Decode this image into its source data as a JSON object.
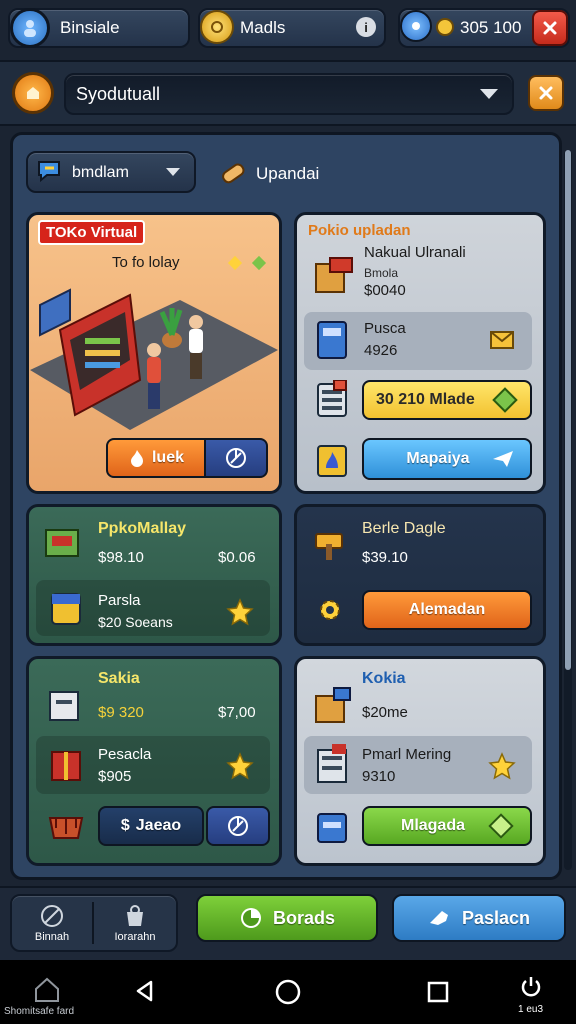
{
  "topbar": {
    "profile_label": "Binsiale",
    "medals_label": "Madls",
    "coins_value": "305 100"
  },
  "header": {
    "dropdown_value": "Syodutuall"
  },
  "subheader": {
    "filter_value": "bmdlam",
    "update_label": "Upandai"
  },
  "cards": {
    "store": {
      "badge": "TOKo Virtual",
      "subtitle": "To fo lolay",
      "primary_label": "luek"
    },
    "updates": {
      "title": "Pokio upladan",
      "item1_name": "Nakual Ulranali",
      "item1_line2": "Bmola",
      "item1_value": "$0040",
      "item2_name": "Pusca",
      "item2_value": "4926",
      "item3_label": "30 210 Mlade",
      "item4_label": "Mapaiya"
    },
    "market": {
      "title": "PpkoMallay",
      "price_left": "$98.10",
      "price_right": "$0.06",
      "item_name": "Parsla",
      "item_value": "$20 Soeans"
    },
    "bundle": {
      "title": "Berle Dagle",
      "price": "$39.10",
      "button_label": "Alemadan"
    },
    "sakla": {
      "title": "Sakia",
      "price_left": "$9 320",
      "price_right": "$7,00",
      "item_name": "Pesacla",
      "item_value": "$905",
      "button_label": "Jaeao"
    },
    "kokia": {
      "title": "Kokia",
      "price": "$20me",
      "item_name": "Pmarl Mering",
      "item_value": "9310",
      "button_label": "Mlagada"
    }
  },
  "bottombar": {
    "tab1": "Binnah",
    "tab2": "Iorarahn",
    "boards_label": "Borads",
    "paslacn_label": "Paslacn"
  },
  "navbar": {
    "caption": "Shomitsafe fard",
    "clock": "1 eu3"
  },
  "colors": {
    "orange": "#f07a1a",
    "green": "#6cc02a",
    "blue": "#3d8fd8",
    "yellow": "#f6d23a",
    "red": "#e23a2a"
  }
}
